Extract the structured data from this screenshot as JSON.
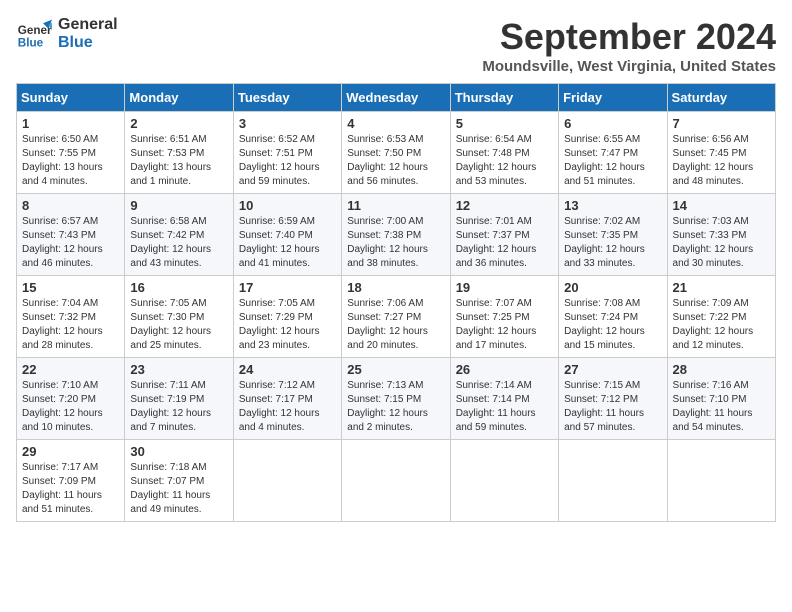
{
  "logo": {
    "line1": "General",
    "line2": "Blue"
  },
  "title": "September 2024",
  "subtitle": "Moundsville, West Virginia, United States",
  "weekdays": [
    "Sunday",
    "Monday",
    "Tuesday",
    "Wednesday",
    "Thursday",
    "Friday",
    "Saturday"
  ],
  "weeks": [
    [
      {
        "day": "1",
        "sunrise": "6:50 AM",
        "sunset": "7:55 PM",
        "daylight": "13 hours and 4 minutes."
      },
      {
        "day": "2",
        "sunrise": "6:51 AM",
        "sunset": "7:53 PM",
        "daylight": "13 hours and 1 minute."
      },
      {
        "day": "3",
        "sunrise": "6:52 AM",
        "sunset": "7:51 PM",
        "daylight": "12 hours and 59 minutes."
      },
      {
        "day": "4",
        "sunrise": "6:53 AM",
        "sunset": "7:50 PM",
        "daylight": "12 hours and 56 minutes."
      },
      {
        "day": "5",
        "sunrise": "6:54 AM",
        "sunset": "7:48 PM",
        "daylight": "12 hours and 53 minutes."
      },
      {
        "day": "6",
        "sunrise": "6:55 AM",
        "sunset": "7:47 PM",
        "daylight": "12 hours and 51 minutes."
      },
      {
        "day": "7",
        "sunrise": "6:56 AM",
        "sunset": "7:45 PM",
        "daylight": "12 hours and 48 minutes."
      }
    ],
    [
      {
        "day": "8",
        "sunrise": "6:57 AM",
        "sunset": "7:43 PM",
        "daylight": "12 hours and 46 minutes."
      },
      {
        "day": "9",
        "sunrise": "6:58 AM",
        "sunset": "7:42 PM",
        "daylight": "12 hours and 43 minutes."
      },
      {
        "day": "10",
        "sunrise": "6:59 AM",
        "sunset": "7:40 PM",
        "daylight": "12 hours and 41 minutes."
      },
      {
        "day": "11",
        "sunrise": "7:00 AM",
        "sunset": "7:38 PM",
        "daylight": "12 hours and 38 minutes."
      },
      {
        "day": "12",
        "sunrise": "7:01 AM",
        "sunset": "7:37 PM",
        "daylight": "12 hours and 36 minutes."
      },
      {
        "day": "13",
        "sunrise": "7:02 AM",
        "sunset": "7:35 PM",
        "daylight": "12 hours and 33 minutes."
      },
      {
        "day": "14",
        "sunrise": "7:03 AM",
        "sunset": "7:33 PM",
        "daylight": "12 hours and 30 minutes."
      }
    ],
    [
      {
        "day": "15",
        "sunrise": "7:04 AM",
        "sunset": "7:32 PM",
        "daylight": "12 hours and 28 minutes."
      },
      {
        "day": "16",
        "sunrise": "7:05 AM",
        "sunset": "7:30 PM",
        "daylight": "12 hours and 25 minutes."
      },
      {
        "day": "17",
        "sunrise": "7:05 AM",
        "sunset": "7:29 PM",
        "daylight": "12 hours and 23 minutes."
      },
      {
        "day": "18",
        "sunrise": "7:06 AM",
        "sunset": "7:27 PM",
        "daylight": "12 hours and 20 minutes."
      },
      {
        "day": "19",
        "sunrise": "7:07 AM",
        "sunset": "7:25 PM",
        "daylight": "12 hours and 17 minutes."
      },
      {
        "day": "20",
        "sunrise": "7:08 AM",
        "sunset": "7:24 PM",
        "daylight": "12 hours and 15 minutes."
      },
      {
        "day": "21",
        "sunrise": "7:09 AM",
        "sunset": "7:22 PM",
        "daylight": "12 hours and 12 minutes."
      }
    ],
    [
      {
        "day": "22",
        "sunrise": "7:10 AM",
        "sunset": "7:20 PM",
        "daylight": "12 hours and 10 minutes."
      },
      {
        "day": "23",
        "sunrise": "7:11 AM",
        "sunset": "7:19 PM",
        "daylight": "12 hours and 7 minutes."
      },
      {
        "day": "24",
        "sunrise": "7:12 AM",
        "sunset": "7:17 PM",
        "daylight": "12 hours and 4 minutes."
      },
      {
        "day": "25",
        "sunrise": "7:13 AM",
        "sunset": "7:15 PM",
        "daylight": "12 hours and 2 minutes."
      },
      {
        "day": "26",
        "sunrise": "7:14 AM",
        "sunset": "7:14 PM",
        "daylight": "11 hours and 59 minutes."
      },
      {
        "day": "27",
        "sunrise": "7:15 AM",
        "sunset": "7:12 PM",
        "daylight": "11 hours and 57 minutes."
      },
      {
        "day": "28",
        "sunrise": "7:16 AM",
        "sunset": "7:10 PM",
        "daylight": "11 hours and 54 minutes."
      }
    ],
    [
      {
        "day": "29",
        "sunrise": "7:17 AM",
        "sunset": "7:09 PM",
        "daylight": "11 hours and 51 minutes."
      },
      {
        "day": "30",
        "sunrise": "7:18 AM",
        "sunset": "7:07 PM",
        "daylight": "11 hours and 49 minutes."
      },
      null,
      null,
      null,
      null,
      null
    ]
  ],
  "labels": {
    "sunrise": "Sunrise:",
    "sunset": "Sunset:",
    "daylight": "Daylight:"
  }
}
